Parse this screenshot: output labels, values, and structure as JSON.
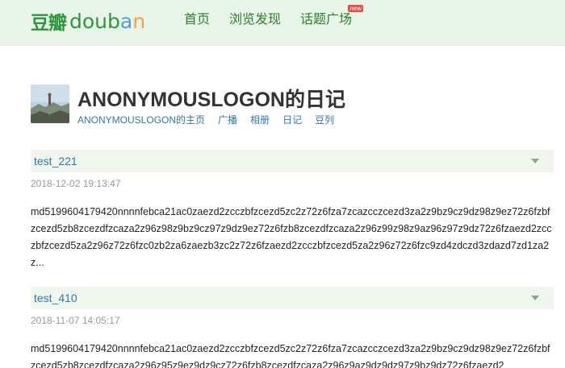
{
  "header": {
    "logo_cn": "豆瓣",
    "logo_en": [
      "d",
      "o",
      "u",
      "b",
      "a",
      "n"
    ],
    "nav": [
      {
        "label": "首页"
      },
      {
        "label": "浏览发现"
      },
      {
        "label": "话题广场",
        "badge": "new"
      }
    ]
  },
  "profile": {
    "title": "ANONYMOUSLOGON的日记",
    "subnav": [
      "ANONYMOUSLOGON的主页",
      "广播",
      "相册",
      "日记",
      "豆列"
    ]
  },
  "entries": [
    {
      "title": "test_221",
      "time": "2018-12-02 19:13:47",
      "body": "md5199604179420nnnnfebca21ac0zaezd2zcczbfzcezd5zc2z72z6fza7zcazcczcezd3za2z9bz9cz9dz98z9ez72z6fzbfzcezd5zb8zcezdfzcaza2z96z98z9bz9cz97z9dz9ez72z6fzb8zcezdfzcaza2z96z99z98z9az96z97z9dz72z6fzaezd2zcczbfzcezd5za2z96z72z6fzc0zb2za6zaezb3zc2z72z6fzaezd2zcczbfzcezd5za2z96z72z6fzc9zd4zdczd3zdazd7zd1za2z..."
    },
    {
      "title": "test_410",
      "time": "2018-11-07 14:05:17",
      "body": "md5199604179420nnnnfebca21ac0zaezd2zcczbfzcezd5zc2z72z6fza7zcazcczcezd3za2z9bz9cz9dz98z9ez72z6fzbfzcezd5zb8zcezdfzcaza2z96z95z9ez9dz9cz72z6fzb8zcezdfzcaza2z96z9az9dz9dz97z9bz9dz72z6fzaezd2"
    }
  ],
  "colors": {
    "topbar_bg": "#e9f4e9",
    "logo_green": "#2e963d",
    "nav_green": "#2c7e2c",
    "link_blue": "#3377aa",
    "entry_head_bg": "#eef6ee",
    "badge_red": "#e94b3c"
  }
}
